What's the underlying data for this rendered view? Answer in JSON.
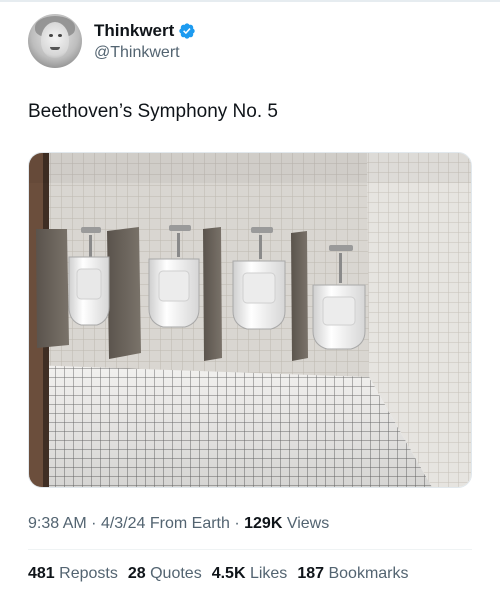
{
  "author": {
    "display_name": "Thinkwert",
    "handle": "@Thinkwert",
    "verified": true,
    "verified_color": "#1d9bf0"
  },
  "tweet": {
    "text": "Beethoven’s Symphony No. 5"
  },
  "meta": {
    "time": "9:38 AM",
    "sep1": "·",
    "date": "4/3/24",
    "source": "From Earth",
    "sep2": "·",
    "views_count": "129K",
    "views_label": "Views"
  },
  "stats": {
    "reposts_count": "481",
    "reposts_label": "Reposts",
    "quotes_count": "28",
    "quotes_label": "Quotes",
    "likes_count": "4.5K",
    "likes_label": "Likes",
    "bookmarks_count": "187",
    "bookmarks_label": "Bookmarks"
  },
  "icons": {
    "verified": "verified-badge-icon"
  }
}
